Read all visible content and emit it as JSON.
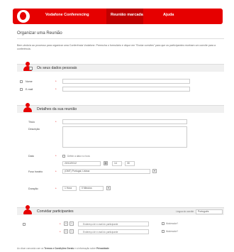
{
  "nav": {
    "items": [
      "Vodafone Conferencing",
      "Reunião marcada",
      "Ajuda"
    ],
    "active_index": 1
  },
  "page": {
    "title": "Organizar uma Reunião",
    "intro": "Bem-vindo/a ao processo para organizar uma Conferência Vodafone. Preencha o formulário e clique em \"Enviar convites\" para que os participantes recebam um convite para a conferência."
  },
  "section_personal": {
    "title": "Os seus dados pessoais",
    "name_label": "Nome",
    "email_label": "E-mail"
  },
  "section_meeting": {
    "title": "Detalhes da sua reunião",
    "title_label": "Título",
    "description_label": "Descrição",
    "date_label": "Data",
    "date_option": "Definir a data e a hora",
    "date_value": "20/12/2012",
    "hour_value": "14",
    "minute_value": "30",
    "timezone_label": "Fuso horário",
    "timezone_value": "(GMT) Portugal, Lisboa",
    "duration_label": "Duração",
    "duration_hours": "1 Hora",
    "duration_minutes": "0 Minutos"
  },
  "section_invite": {
    "title": "Convidar participantes",
    "language_label": "Língua do convite",
    "language_value": "Português",
    "email_placeholder": "Endereço de e-mail do participante",
    "moderator_label": "Moderador?"
  },
  "footer": {
    "prefix": "Ao clicar concorda com os",
    "terms": "Termos e Condições Gerais",
    "middle": "e a informação sobre",
    "privacy": "Privacidade"
  },
  "colors": {
    "brand_red": "#e60000",
    "active_red": "#c00000"
  }
}
